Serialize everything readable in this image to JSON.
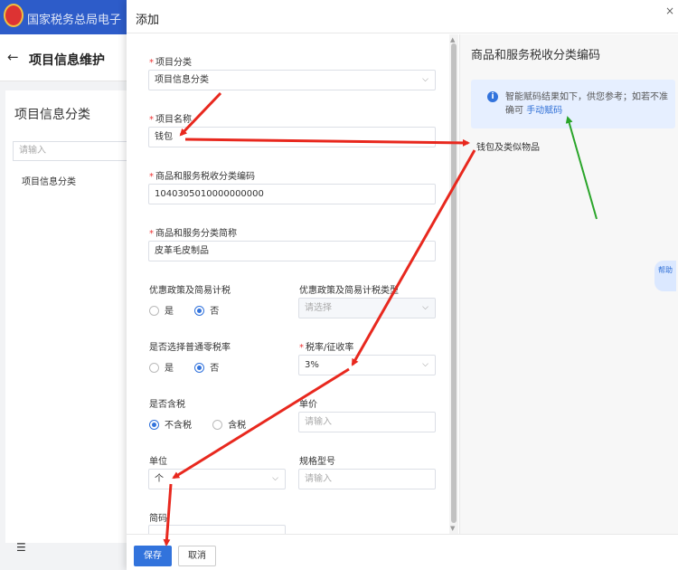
{
  "background": {
    "app_title": "国家税务总局电子",
    "page_title": "项目信息维护",
    "panel_title": "项目信息分类",
    "search_placeholder": "请输入",
    "tree_item": "项目信息分类",
    "menu_glyph": "☰"
  },
  "dialog": {
    "title": "添加",
    "close": "×"
  },
  "form": {
    "category": {
      "label": "项目分类",
      "value": "项目信息分类"
    },
    "name": {
      "label": "项目名称",
      "value": "钱包"
    },
    "tax_code": {
      "label": "商品和服务税收分类编码",
      "value": "1040305010000000000"
    },
    "tax_abbr": {
      "label": "商品和服务分类简称",
      "value": "皮革毛皮制品"
    },
    "preferential": {
      "label": "优惠政策及简易计税",
      "yes": "是",
      "no": "否",
      "selected": "no"
    },
    "preferential_type": {
      "label": "优惠政策及简易计税类型",
      "placeholder": "请选择"
    },
    "zero_rate": {
      "label": "是否选择普通零税率",
      "yes": "是",
      "no": "否",
      "selected": "no"
    },
    "tax_rate": {
      "label": "税率/征收率",
      "value": "3%"
    },
    "tax_included": {
      "label": "是否含税",
      "no": "不含税",
      "yes": "含税",
      "selected": "no"
    },
    "unit_price": {
      "label": "单价",
      "placeholder": "请输入"
    },
    "unit": {
      "label": "单位",
      "value": "个"
    },
    "spec": {
      "label": "规格型号",
      "placeholder": "请输入"
    },
    "short_code": {
      "label": "简码"
    }
  },
  "right_panel": {
    "title": "商品和服务税收分类编码",
    "tip_text": "智能赋码结果如下，供您参考；如若不准确可",
    "tip_link": "手动赋码",
    "result": "钱包及类似物品",
    "helper_text": "帮助"
  },
  "footer": {
    "save": "保存",
    "cancel": "取消"
  },
  "colors": {
    "primary": "#3273dc",
    "header_blue": "#2d5cc9",
    "arrow_red": "#e8281e",
    "arrow_green": "#2aa52a"
  }
}
